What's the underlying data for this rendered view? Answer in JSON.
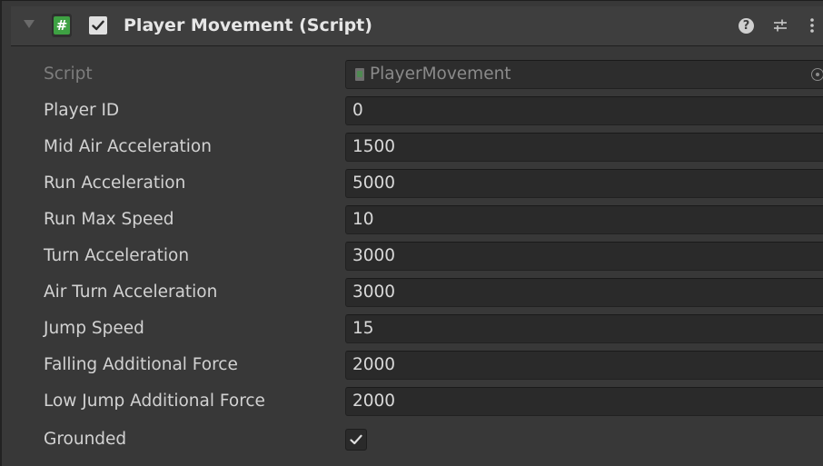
{
  "component": {
    "title": "Player Movement (Script)",
    "script_icon_glyph": "#",
    "help_glyph": "?",
    "enabled": true,
    "icons": [
      "script-icon",
      "help-icon",
      "preset-icon",
      "kebab-menu-icon",
      "foldout-arrow-icon",
      "checkmark-icon",
      "object-picker-icon"
    ]
  },
  "script_field": {
    "label": "Script",
    "value": "PlayerMovement"
  },
  "fields": [
    {
      "label": "Player ID",
      "value": "0"
    },
    {
      "label": "Mid Air Acceleration",
      "value": "1500"
    },
    {
      "label": "Run Acceleration",
      "value": "5000"
    },
    {
      "label": "Run Max Speed",
      "value": "10"
    },
    {
      "label": "Turn Acceleration",
      "value": "3000"
    },
    {
      "label": "Air Turn Acceleration",
      "value": "3000"
    },
    {
      "label": "Jump Speed",
      "value": "15"
    },
    {
      "label": "Falling Additional Force",
      "value": "2000"
    },
    {
      "label": "Low Jump Additional Force",
      "value": "2000"
    }
  ],
  "grounded": {
    "label": "Grounded",
    "checked": true
  },
  "colors": {
    "background": "#383838",
    "field_background": "#2a2a2a",
    "label_text": "#d2d2d2",
    "script_icon_green": "#3ea143"
  }
}
